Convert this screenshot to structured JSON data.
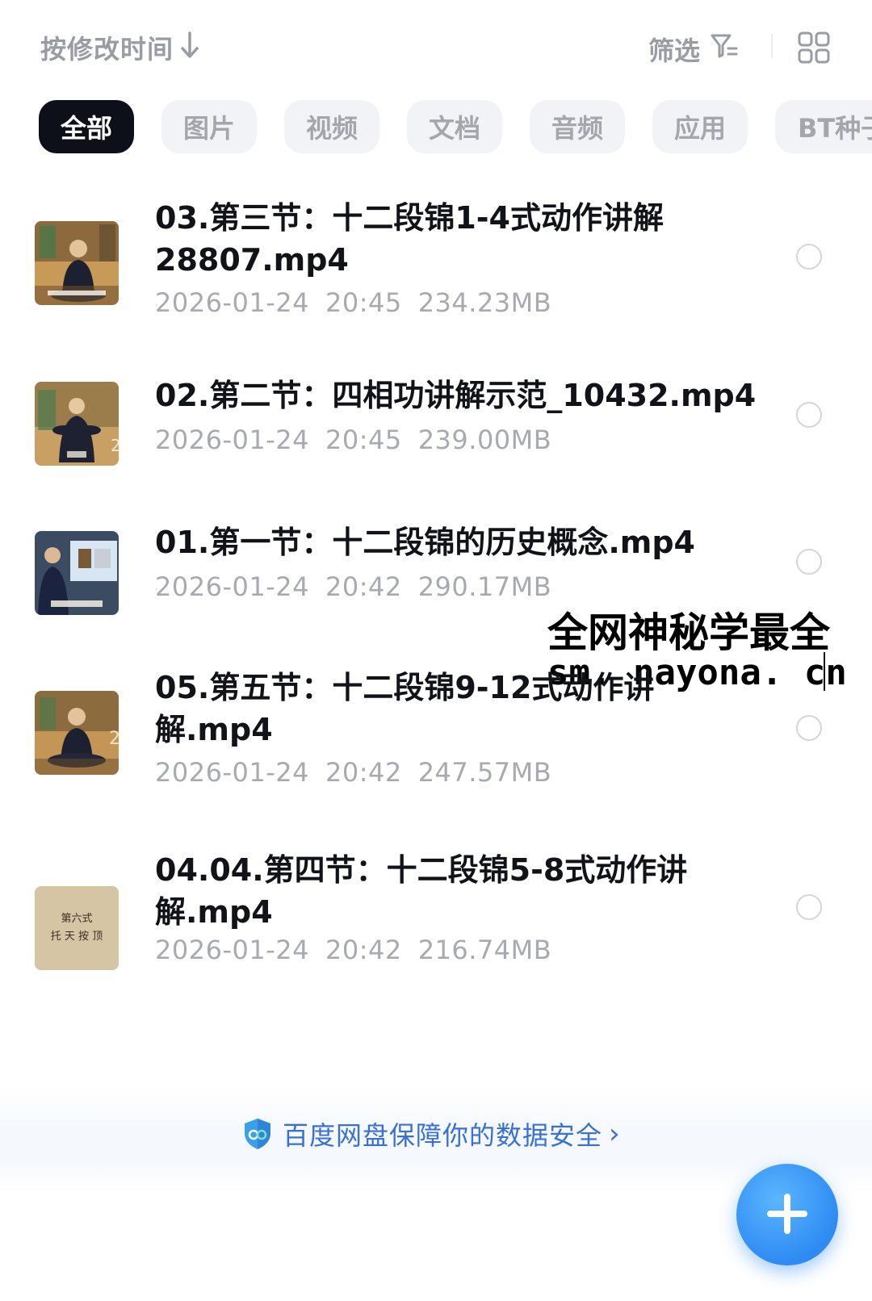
{
  "sortbar": {
    "sort_label": "按修改时间",
    "sort_icon": "arrow-down-icon",
    "filter_label": "筛选",
    "filter_icon": "filter-icon",
    "view_icon": "grid-view-icon"
  },
  "tabs": [
    {
      "label": "全部",
      "active": true
    },
    {
      "label": "图片",
      "active": false
    },
    {
      "label": "视频",
      "active": false
    },
    {
      "label": "文档",
      "active": false
    },
    {
      "label": "音频",
      "active": false
    },
    {
      "label": "应用",
      "active": false
    },
    {
      "label": "BT种子",
      "active": false
    }
  ],
  "files": [
    {
      "name": "03.第三节：十二段锦1-4式动作讲解28807.mp4",
      "date": "2026-01-24",
      "time": "20:45",
      "size": "234.23MB"
    },
    {
      "name": "02.第二节：四相功讲解示范_10432.mp4",
      "date": "2026-01-24",
      "time": "20:45",
      "size": "239.00MB"
    },
    {
      "name": "01.第一节：十二段锦的历史概念.mp4",
      "date": "2026-01-24",
      "time": "20:42",
      "size": "290.17MB"
    },
    {
      "name": "05.第五节：十二段锦9-12式动作讲解.mp4",
      "date": "2026-01-24",
      "time": "20:42",
      "size": "247.57MB"
    },
    {
      "name": "04.04.第四节：十二段锦5-8式动作讲解.mp4",
      "date": "2026-01-24",
      "time": "20:42",
      "size": "216.74MB"
    }
  ],
  "thumb5_text": [
    "第六式",
    "托 天 按 顶"
  ],
  "watermark": {
    "line1": "全网神秘学最全",
    "line2": "sm. nayona. cn"
  },
  "footer": {
    "secure_text": "百度网盘保障你的数据安全",
    "secure_icon": "shield-icon",
    "fab_icon": "plus-icon"
  },
  "colors": {
    "accent": "#3a6fd8",
    "fab": "#2e8bf2",
    "tab_active_bg": "#0d1019"
  }
}
